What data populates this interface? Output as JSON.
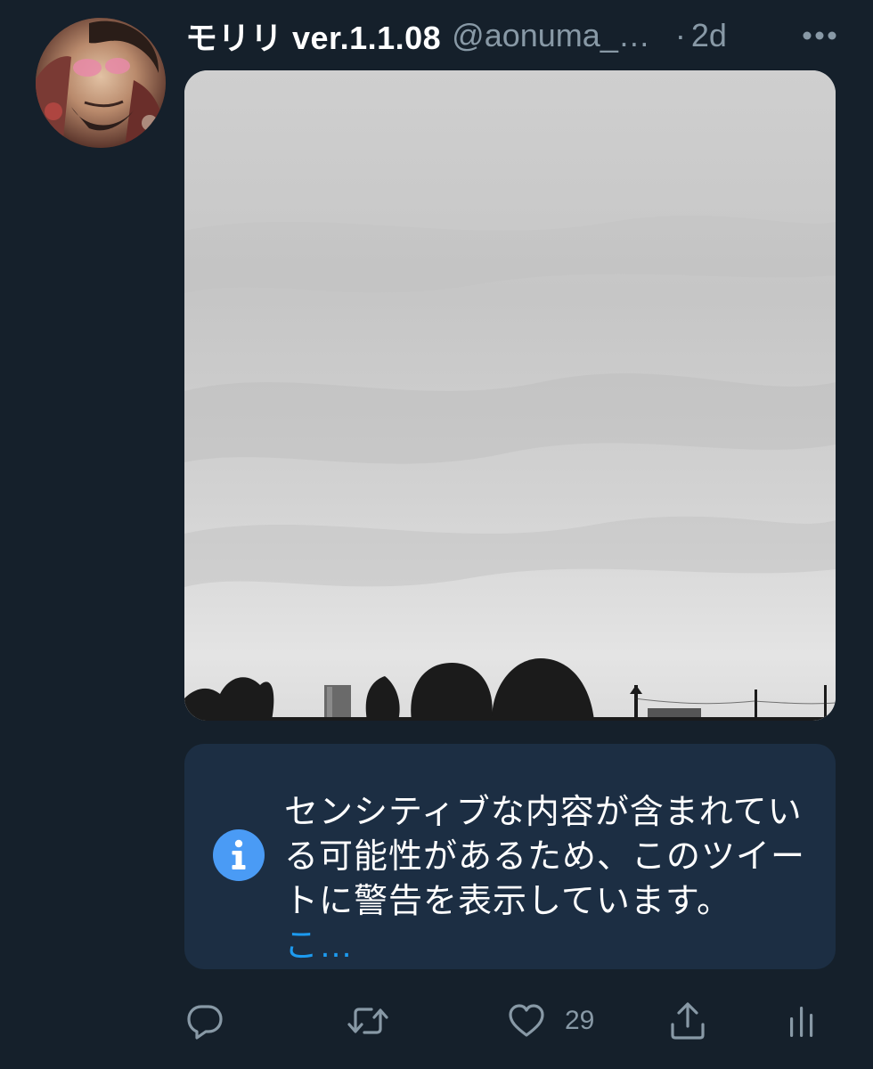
{
  "tweet": {
    "display_name": "モリリ ver.1.1.08",
    "handle": "@aonuma_…",
    "separator": "·",
    "time": "2d",
    "more_icon": "more-horizontal-icon"
  },
  "sensitive_warning": {
    "icon": "info-icon",
    "text": "センシティブな内容が含まれている可能性があるため、このツイートに警告を表示しています。",
    "link_text": "こ…"
  },
  "actions": {
    "reply_icon": "reply-icon",
    "retweet_icon": "retweet-icon",
    "like_icon": "heart-icon",
    "like_count": "29",
    "share_icon": "share-icon",
    "analytics_icon": "analytics-icon"
  },
  "colors": {
    "background": "#15202b",
    "secondary_text": "#8899a6",
    "link": "#1d9bf0",
    "warning_background": "#1c2e43",
    "info_icon": "#4a9bf5"
  }
}
